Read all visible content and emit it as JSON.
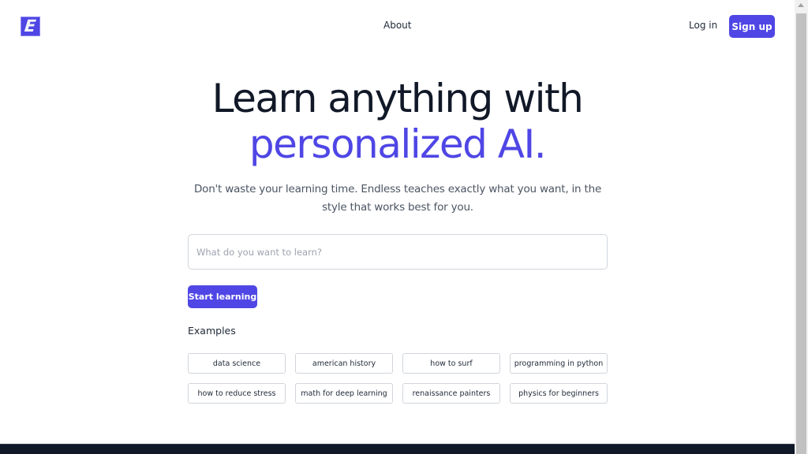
{
  "header": {
    "logo_letter": "E",
    "nav": {
      "about": "About"
    },
    "login_label": "Log in",
    "signup_label": "Sign up"
  },
  "hero": {
    "title_line1": "Learn anything with",
    "title_line2": "personalized AI.",
    "subtitle": "Don't waste your learning time. Endless teaches exactly what you want, in the style that works best for you."
  },
  "search": {
    "placeholder": "What do you want to learn?",
    "value": ""
  },
  "start_button": "Start learning",
  "examples": {
    "label": "Examples",
    "items": [
      "data science",
      "american history",
      "how to surf",
      "programming in python",
      "how to reduce stress",
      "math for deep learning",
      "renaissance painters",
      "physics for beginners"
    ]
  },
  "colors": {
    "brand": "#4f46e5",
    "text_dark": "#111827",
    "footer": "#111827"
  }
}
